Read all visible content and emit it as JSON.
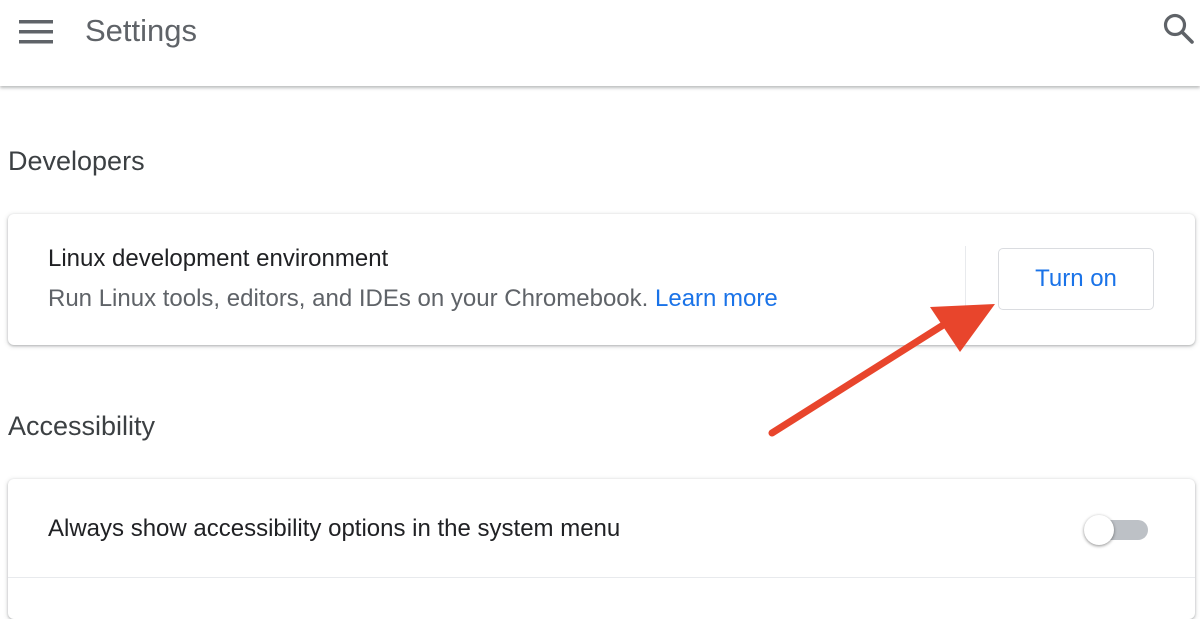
{
  "header": {
    "menu_icon": "hamburger-menu-icon",
    "title": "Settings",
    "search_icon": "search-icon"
  },
  "sections": {
    "developers": {
      "title": "Developers",
      "linux": {
        "title": "Linux development environment",
        "description": "Run Linux tools, editors, and IDEs on your Chromebook.",
        "learn_more": "Learn more",
        "button_label": "Turn on"
      }
    },
    "accessibility": {
      "title": "Accessibility",
      "always_show": {
        "label": "Always show accessibility options in the system menu",
        "toggle_on": false
      }
    }
  },
  "annotation": {
    "arrow_color": "#e8452c",
    "target": "turn-on-button"
  },
  "colors": {
    "accent": "#1a73e8",
    "title_gray": "#5f6368",
    "text_dark": "#202124"
  }
}
